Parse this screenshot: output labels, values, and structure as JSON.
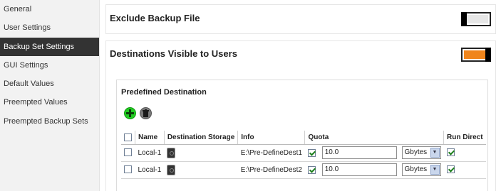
{
  "sidebar": {
    "items": [
      {
        "label": "General"
      },
      {
        "label": "User Settings"
      },
      {
        "label": "Backup Set Settings"
      },
      {
        "label": "GUI Settings"
      },
      {
        "label": "Default Values"
      },
      {
        "label": "Preempted Values"
      },
      {
        "label": "Preempted Backup Sets"
      }
    ],
    "active_index": 2
  },
  "panels": {
    "exclude": {
      "title": "Exclude Backup File",
      "toggle": "off"
    },
    "destinations": {
      "title": "Destinations Visible to Users",
      "toggle": "on"
    }
  },
  "predefined": {
    "title": "Predefined Destination",
    "add_icon": "add-icon",
    "delete_icon": "trash-icon",
    "columns": [
      "Name",
      "Destination Storage",
      "Info",
      "Quota",
      "Run Direct"
    ],
    "rows": [
      {
        "name": "Local-1",
        "info": "E:\\Pre-DefineDest1",
        "quota_checked": true,
        "quota": "10.0",
        "unit": "Gbytes",
        "run_direct": true
      },
      {
        "name": "Local-1",
        "info": "E:\\Pre-DefineDest2",
        "quota_checked": true,
        "quota": "10.0",
        "unit": "Gbytes",
        "run_direct": true
      }
    ]
  },
  "colors": {
    "toggle_on": "#f0851c",
    "active_sidebar": "#333333",
    "add_button": "#22cc22"
  }
}
